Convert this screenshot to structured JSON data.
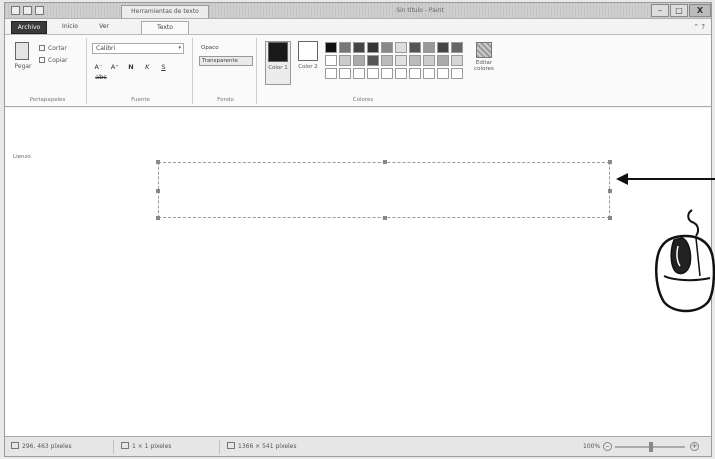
{
  "title_bar": {
    "context_tab": "Herramientas de texto",
    "window_title": "Sin título - Paint",
    "min": "–",
    "max": "□",
    "close": "X"
  },
  "tabs": {
    "file": "Archivo",
    "home": "Inicio",
    "view": "Ver",
    "text": "Texto",
    "help_icons": "⌃ ?"
  },
  "ribbon": {
    "clipboard": {
      "paste": "Pegar",
      "cut": "Cortar",
      "copy": "Copiar",
      "group_label": "Portapapeles"
    },
    "font": {
      "family": "Calibri",
      "arrow": "▾",
      "size_down": "A⁻",
      "size_up": "A⁺",
      "bold": "N",
      "italic": "K",
      "underline": "S",
      "strike": "abc",
      "group_label": "Fuente"
    },
    "background": {
      "opaque": "Opaco",
      "transparent": "Transparente",
      "group_label": "Fondo"
    },
    "colors": {
      "color1_label": "Color 1",
      "color2_label": "Color 2",
      "color1": "#1a1a1a",
      "color2": "#ffffff",
      "edit_label": "Editar colores",
      "group_label": "Colores",
      "palette": [
        "#111111",
        "#777777",
        "#444444",
        "#333333",
        "#888888",
        "#dddddd",
        "#555555",
        "#999999",
        "#444444",
        "#666666",
        "#ffffff",
        "#cccccc",
        "#aaaaaa",
        "#555555",
        "#bbbbbb",
        "#e0e0e0",
        "#bbbbbb",
        "#cccccc",
        "#aaaaaa",
        "#d5d5d5",
        "#ffffff",
        "#ffffff",
        "#ffffff",
        "#ffffff",
        "#ffffff",
        "#ffffff",
        "#ffffff",
        "#ffffff",
        "#ffffff",
        "#ffffff"
      ]
    }
  },
  "canvas": {
    "side_label": "Lienzo"
  },
  "status_bar": {
    "cursor_pos": "296, 463 píxeles",
    "selection_size": "1 × 1 píxeles",
    "image_size": "1366 × 541 píxeles",
    "zoom": "100%",
    "zoom_out": "–",
    "zoom_in": "+"
  }
}
